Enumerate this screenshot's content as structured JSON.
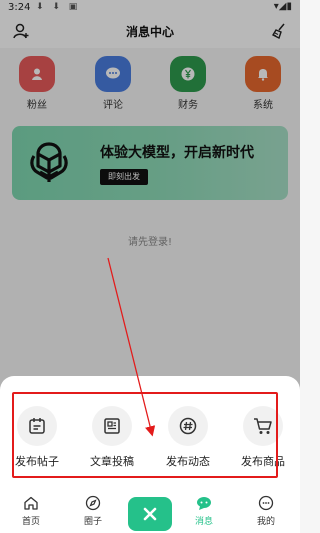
{
  "status_bar": {
    "time": "3:24"
  },
  "header": {
    "title": "消息中心"
  },
  "categories": [
    {
      "label": "粉丝",
      "icon": "person-icon",
      "color": "#e85b5b"
    },
    {
      "label": "评论",
      "icon": "comment-icon",
      "color": "#4a7de0"
    },
    {
      "label": "财务",
      "icon": "yuan-icon",
      "color": "#2e9b4e"
    },
    {
      "label": "系统",
      "icon": "bell-icon",
      "color": "#e8682e"
    }
  ],
  "banner": {
    "headline": "体验大模型，开启新时代",
    "button_label": "即刻出发"
  },
  "login_hint": "请先登录!",
  "publish_actions": [
    {
      "label": "发布帖子",
      "icon": "calendar-icon"
    },
    {
      "label": "文章投稿",
      "icon": "article-icon"
    },
    {
      "label": "发布动态",
      "icon": "hashtag-icon"
    },
    {
      "label": "发布商品",
      "icon": "cart-icon"
    }
  ],
  "tabbar": [
    {
      "label": "首页",
      "icon": "home-icon"
    },
    {
      "label": "圈子",
      "icon": "compass-icon"
    },
    {
      "label": "消息",
      "icon": "message-icon",
      "active": true
    },
    {
      "label": "我的",
      "icon": "profile-icon"
    }
  ],
  "colors": {
    "accent": "#25c18a",
    "highlight_box": "#e31b1b"
  }
}
